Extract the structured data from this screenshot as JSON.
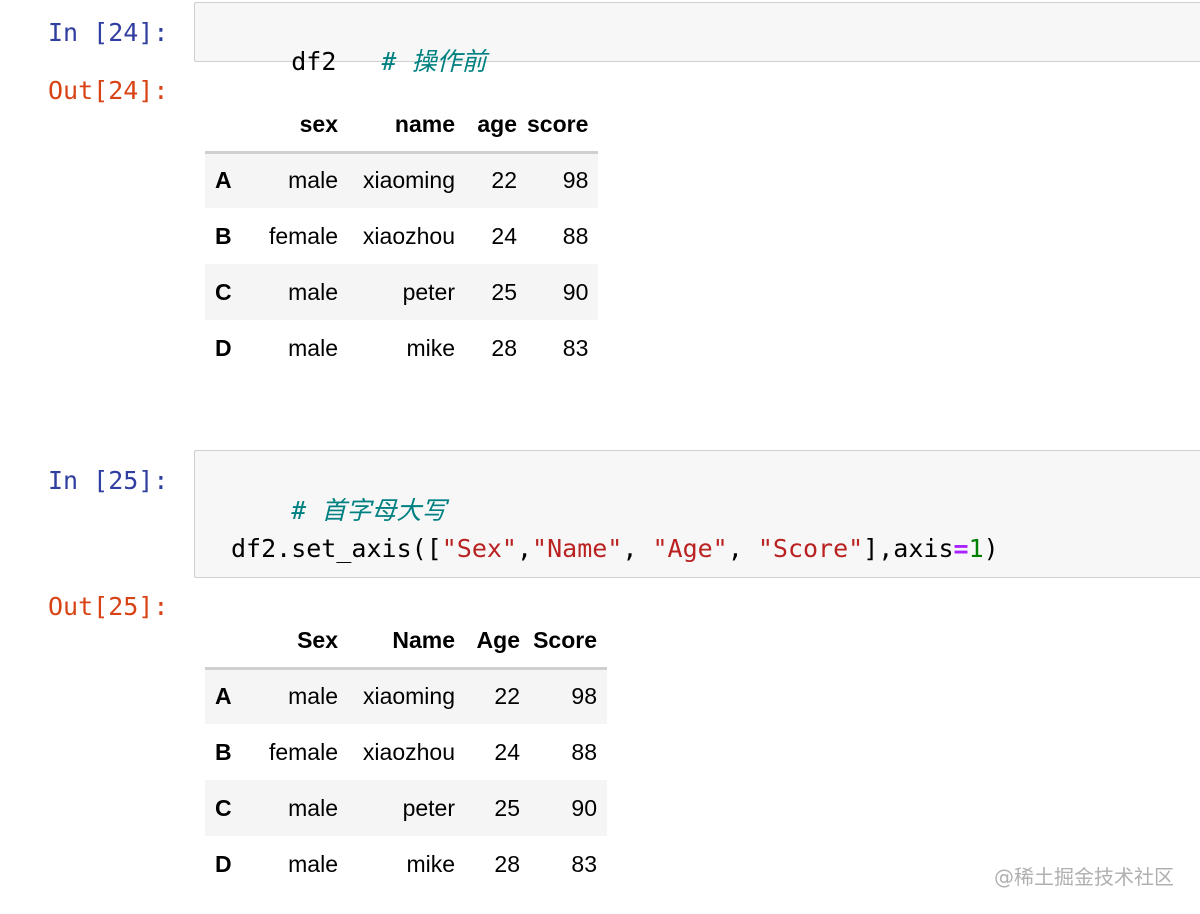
{
  "cell1": {
    "in_prompt": "In [24]:",
    "code_main": "df2",
    "code_comment": "# 操作前",
    "out_prompt": "Out[24]:",
    "table": {
      "columns": [
        "sex",
        "name",
        "age",
        "score"
      ],
      "rows": [
        {
          "index": "A",
          "values": [
            "male",
            "xiaoming",
            "22",
            "98"
          ]
        },
        {
          "index": "B",
          "values": [
            "female",
            "xiaozhou",
            "24",
            "88"
          ]
        },
        {
          "index": "C",
          "values": [
            "male",
            "peter",
            "25",
            "90"
          ]
        },
        {
          "index": "D",
          "values": [
            "male",
            "mike",
            "28",
            "83"
          ]
        }
      ]
    }
  },
  "cell2": {
    "in_prompt": "In [25]:",
    "comment": "# 首字母大写",
    "code": {
      "prefix": "df2.set_axis([",
      "str1": "\"Sex\"",
      "sep1": ",",
      "str2": "\"Name\"",
      "sep2": ", ",
      "str3": "\"Age\"",
      "sep3": ", ",
      "str4": "\"Score\"",
      "mid": "],axis",
      "op": "=",
      "num": "1",
      "suffix": ")"
    },
    "out_prompt": "Out[25]:",
    "table": {
      "columns": [
        "Sex",
        "Name",
        "Age",
        "Score"
      ],
      "rows": [
        {
          "index": "A",
          "values": [
            "male",
            "xiaoming",
            "22",
            "98"
          ]
        },
        {
          "index": "B",
          "values": [
            "female",
            "xiaozhou",
            "24",
            "88"
          ]
        },
        {
          "index": "C",
          "values": [
            "male",
            "peter",
            "25",
            "90"
          ]
        },
        {
          "index": "D",
          "values": [
            "male",
            "mike",
            "28",
            "83"
          ]
        }
      ]
    }
  },
  "watermark": "@稀土掘金技术社区",
  "colors": {
    "in_prompt": "#303f9f",
    "out_prompt": "#d84315",
    "comment": "#008080",
    "string": "#ba2121",
    "operator": "#aa22ff",
    "number": "#008000"
  }
}
